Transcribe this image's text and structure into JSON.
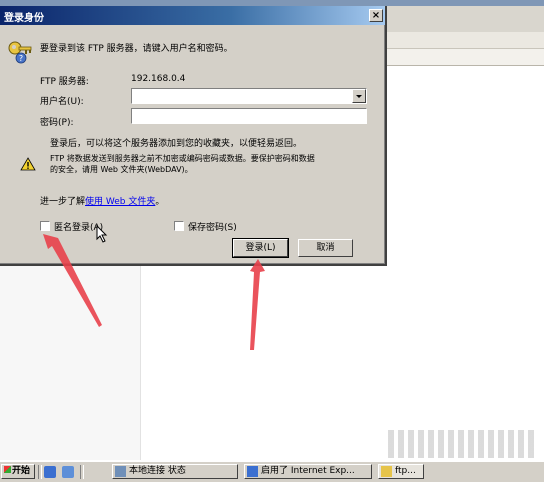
{
  "dialog": {
    "title": "登录身份",
    "close_glyph": "×",
    "prompt": "要登录到该 FTP 服务器，请键入用户名和密码。",
    "server_label": "FTP 服务器:",
    "server_value": "192.168.0.4",
    "username_label": "用户名(U):",
    "username_value": "",
    "password_label": "密码(P):",
    "password_value": "",
    "info_text": "登录后，可以将这个服务器添加到您的收藏夹，以便轻易返回。",
    "warning_line1": "FTP 将数据发送到服务器之前不加密或编码密码或数据。要保护密码和数据",
    "warning_line2": "的安全，请用 Web 文件夹(WebDAV)。",
    "learn_prefix": "进一步了解",
    "learn_link": "使用 Web 文件夹",
    "learn_suffix": "。",
    "anonymous_label": "匿名登录(A)",
    "anonymous_checked": false,
    "save_password_label": "保存密码(S)",
    "save_password_checked": false,
    "login_button": "登录(L)",
    "cancel_button": "取消"
  },
  "taskbar": {
    "start_label": "开始",
    "items": [
      "本地连接 状态",
      "启用了 Internet Exp...",
      "ftp..."
    ]
  },
  "annotations": {
    "arrow_color": "#e8404a"
  }
}
